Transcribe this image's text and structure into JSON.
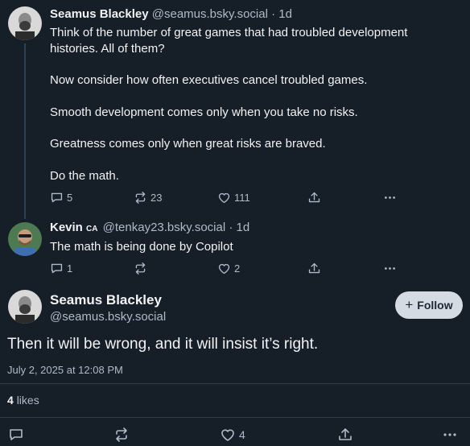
{
  "colors": {
    "background": "#161e27",
    "text": "#f1f3f5",
    "muted": "#aebbc9",
    "thread_line": "#2e4052",
    "follow_bg": "#d4dbe2"
  },
  "posts": [
    {
      "author_name": "Seamus Blackley",
      "handle": "@seamus.bsky.social",
      "sep": "·",
      "age": "1d",
      "paragraphs": [
        "Think of the number of great games that had troubled development histories. All of them?",
        "Now consider how often executives cancel troubled games.",
        "Smooth development comes only when you take no risks.",
        "Greatness comes only when great risks are braved.",
        "Do the math."
      ],
      "replies": "5",
      "reposts": "23",
      "likes": "111"
    },
    {
      "author_name": "Kevin",
      "badge": "CA",
      "handle": "@tenkay23.bsky.social",
      "sep": "·",
      "age": "1d",
      "paragraphs": [
        "The math is being done by Copilot"
      ],
      "replies": "1",
      "reposts": "",
      "likes": "2"
    }
  ],
  "main_post": {
    "author_name": "Seamus Blackley",
    "handle": "@seamus.bsky.social",
    "follow_label": "Follow",
    "follow_plus": "+",
    "text": "Then it will be wrong, and it will insist it’s right.",
    "timestamp": "July 2, 2025 at 12:08 PM",
    "likes_count": "4",
    "likes_label": "likes",
    "like_action_count": "4"
  },
  "icons": [
    "reply-icon",
    "repost-icon",
    "like-icon",
    "share-icon",
    "more-icon",
    "plus-icon"
  ]
}
